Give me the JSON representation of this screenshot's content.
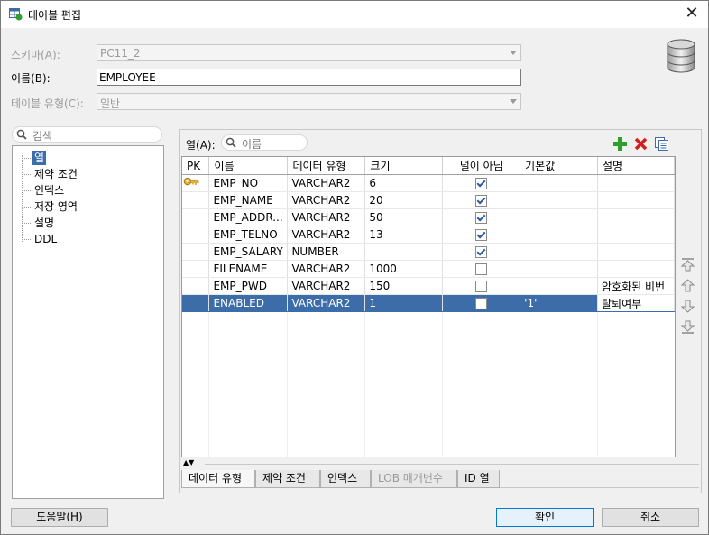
{
  "window": {
    "title": "테이블 편집"
  },
  "form": {
    "schema_label": "스키마(A):",
    "schema_value": "PC11_2",
    "name_label": "이름(B):",
    "name_value": "EMPLOYEE",
    "table_type_label": "테이블 유형(C):",
    "table_type_value": "일반"
  },
  "left_search": {
    "placeholder": "검색"
  },
  "tree": {
    "items": [
      "열",
      "제약 조건",
      "인덱스",
      "저장 영역",
      "설명",
      "DDL"
    ],
    "selected": 0
  },
  "columns_panel": {
    "label": "열(A):",
    "search_placeholder": "이름",
    "headers": [
      "PK",
      "이름",
      "데이터 유형",
      "크기",
      "널이 아님",
      "기본값",
      "설명"
    ],
    "rows": [
      {
        "pk": true,
        "name": "EMP_NO",
        "type": "VARCHAR2",
        "size": "6",
        "not_null": true,
        "default": "",
        "desc": ""
      },
      {
        "pk": false,
        "name": "EMP_NAME",
        "type": "VARCHAR2",
        "size": "20",
        "not_null": true,
        "default": "",
        "desc": ""
      },
      {
        "pk": false,
        "name": "EMP_ADDR...",
        "type": "VARCHAR2",
        "size": "50",
        "not_null": true,
        "default": "",
        "desc": ""
      },
      {
        "pk": false,
        "name": "EMP_TELNO",
        "type": "VARCHAR2",
        "size": "13",
        "not_null": true,
        "default": "",
        "desc": ""
      },
      {
        "pk": false,
        "name": "EMP_SALARY",
        "type": "NUMBER",
        "size": "",
        "not_null": true,
        "default": "",
        "desc": ""
      },
      {
        "pk": false,
        "name": "FILENAME",
        "type": "VARCHAR2",
        "size": "1000",
        "not_null": false,
        "default": "",
        "desc": ""
      },
      {
        "pk": false,
        "name": "EMP_PWD",
        "type": "VARCHAR2",
        "size": "150",
        "not_null": false,
        "default": "",
        "desc": "암호화된 비번"
      },
      {
        "pk": false,
        "name": "ENABLED",
        "type": "VARCHAR2",
        "size": "1",
        "not_null": false,
        "default": "'1'",
        "desc": "탈퇴여부"
      }
    ],
    "selected_row": 7
  },
  "bottom_tabs": [
    {
      "label": "데이터 유형",
      "disabled": false
    },
    {
      "label": "제약 조건",
      "disabled": false
    },
    {
      "label": "인덱스",
      "disabled": false
    },
    {
      "label": "LOB 매개변수",
      "disabled": true
    },
    {
      "label": "ID 열",
      "disabled": false
    }
  ],
  "buttons": {
    "help": "도움말(H)",
    "ok": "확인",
    "cancel": "취소"
  },
  "colors": {
    "selection": "#3c6da8",
    "add": "#2e9e2e",
    "remove": "#d02020"
  }
}
